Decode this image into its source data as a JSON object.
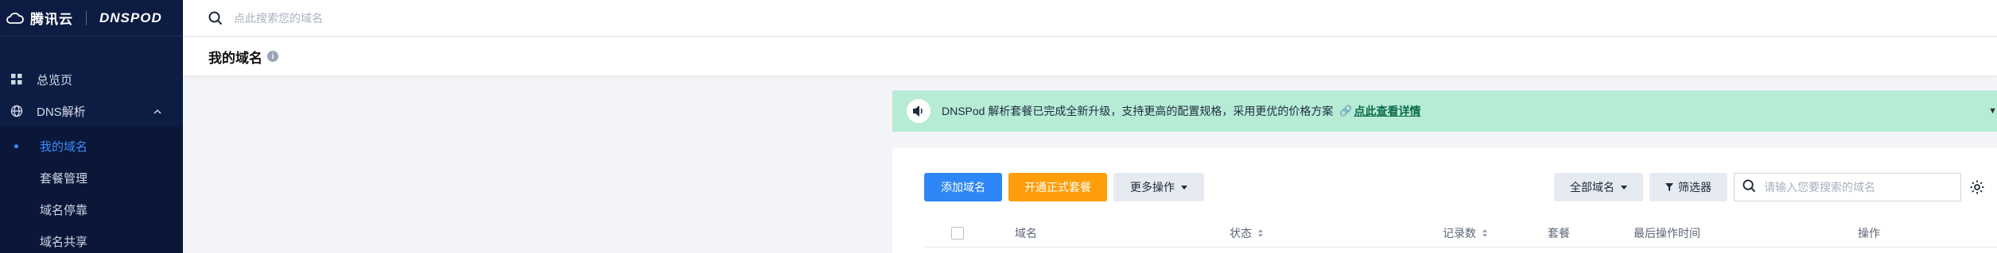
{
  "brand": {
    "tencent": "腾讯云",
    "product": "DNSPOD"
  },
  "search": {
    "placeholder": "点此搜索您的域名"
  },
  "sidebar": {
    "items": [
      {
        "label": "总览页"
      },
      {
        "label": "DNS解析"
      }
    ],
    "subitems": [
      {
        "label": "我的域名",
        "active": true
      },
      {
        "label": "套餐管理"
      },
      {
        "label": "域名停靠"
      },
      {
        "label": "域名共享"
      }
    ]
  },
  "page": {
    "title": "我的域名",
    "info_glyph": "i"
  },
  "notice": {
    "text": "DNSPod 解析套餐已完成全新升级，支持更高的配置规格，采用更优的价格方案",
    "link": "点此查看详情",
    "bg_color": "#b6ecd6"
  },
  "toolbar": {
    "add_label": "添加域名",
    "open_label": "开通正式套餐",
    "more_label": "更多操作",
    "all_label": "全部域名",
    "filter_label": "筛选器",
    "search_placeholder": "请输入您要搜索的域名"
  },
  "table": {
    "columns": [
      "域名",
      "状态",
      "记录数",
      "套餐",
      "最后操作时间",
      "操作"
    ]
  },
  "colors": {
    "sidebar": "#0c1c43",
    "primary": "#2f86f6",
    "accent": "#ff9d0a"
  }
}
